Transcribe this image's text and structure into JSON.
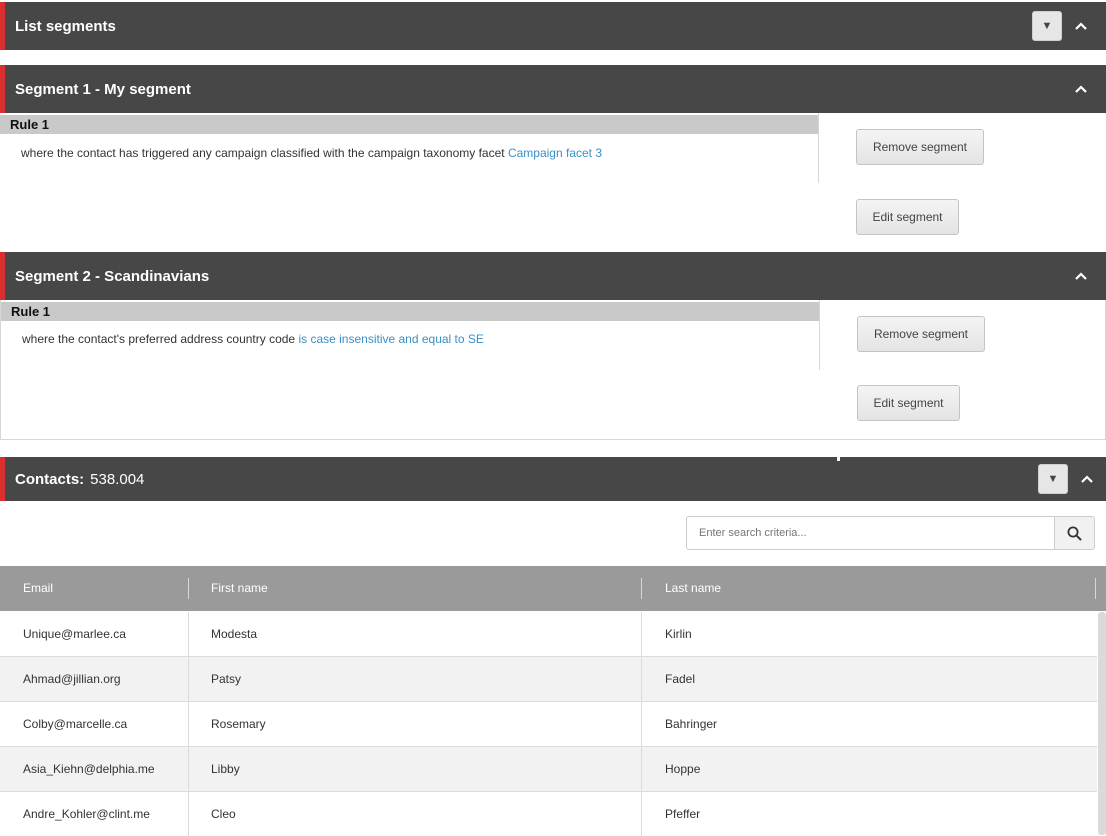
{
  "list_segments": {
    "title": "List segments"
  },
  "segments": [
    {
      "title": "Segment 1 - My segment",
      "rule_label": "Rule 1",
      "rule_text": "where the contact has triggered any campaign classified with the campaign taxonomy facet",
      "rule_link": "Campaign facet 3",
      "remove_label": "Remove segment",
      "edit_label": "Edit segment"
    },
    {
      "title": "Segment 2 - Scandinavians",
      "rule_label": "Rule 1",
      "rule_text": "where the contact's preferred address country code",
      "rule_link": "is case insensitive and equal to SE",
      "remove_label": "Remove segment",
      "edit_label": "Edit segment"
    }
  ],
  "contacts": {
    "label": "Contacts:",
    "count": "538.004",
    "search_placeholder": "Enter search criteria...",
    "columns": [
      "Email",
      "First name",
      "Last name"
    ],
    "rows": [
      {
        "email": "Unique@marlee.ca",
        "first": "Modesta",
        "last": "Kirlin"
      },
      {
        "email": "Ahmad@jillian.org",
        "first": "Patsy",
        "last": "Fadel"
      },
      {
        "email": "Colby@marcelle.ca",
        "first": "Rosemary",
        "last": "Bahringer"
      },
      {
        "email": "Asia_Kiehn@delphia.me",
        "first": "Libby",
        "last": "Hoppe"
      },
      {
        "email": "Andre_Kohler@clint.me",
        "first": "Cleo",
        "last": "Pfeffer"
      }
    ]
  },
  "icons": {
    "dropdown": "caret-down-icon",
    "collapse": "chevron-up-icon",
    "search": "search-icon"
  },
  "colors": {
    "accent": "#d9302f",
    "header_bg": "#474747",
    "link": "#3a8fc7",
    "table_header": "#9a9a9a"
  }
}
